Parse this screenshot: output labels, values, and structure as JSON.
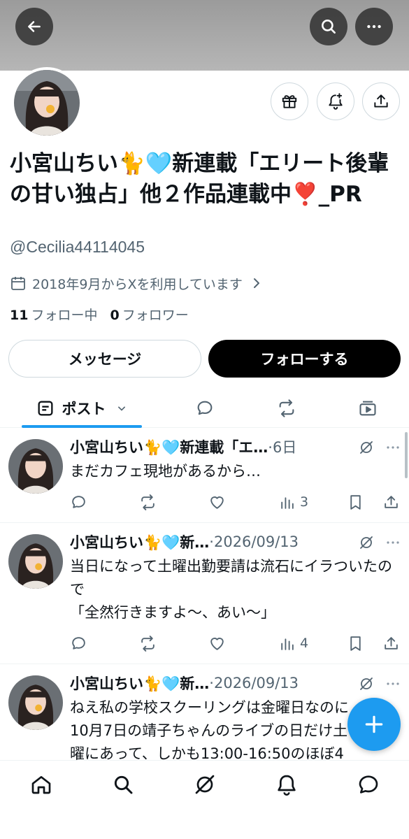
{
  "profile": {
    "display_name": "小宮山ちい🐈🩵新連載「エリート後輩の甘い独占」他２作品連載中❣️_PR",
    "handle": "@Cecilia44114045",
    "joined": "2018年9月からXを利用しています",
    "following_count": "11",
    "following_label": "フォロー中",
    "followers_count": "0",
    "followers_label": "フォロワー"
  },
  "buttons": {
    "message": "メッセージ",
    "follow": "フォローする"
  },
  "tabs": {
    "active_label": "ポスト",
    "items": [
      "posts-tab",
      "replies-tab",
      "reposts-tab",
      "media-tab"
    ]
  },
  "posts": [
    {
      "name": "小宮山ちい🐈🩵新連載「エ…",
      "date": "·6日",
      "body": "まだカフェ現地があるから…",
      "views": "3"
    },
    {
      "name": "小宮山ちい🐈🩵新…",
      "date": "·2026/09/13",
      "body": "当日になって土曜出勤要請は流石にイラついたので\n「全然行きますよ〜、あい〜」",
      "views": "4"
    },
    {
      "name": "小宮山ちい🐈🩵新…",
      "date": "·2026/09/13",
      "body": "ねえ私の学校スクーリングは金曜日なのに\n10月7日の靖子ちゃんのライブの日だけ土\n曜にあって、しかも13:00-16:50のほぼ4",
      "views": ""
    }
  ],
  "colors": {
    "accent": "#1d9bf0",
    "text": "#0f1419",
    "secondary": "#536471",
    "follow_button": "#000000"
  },
  "icons": {
    "header": [
      "back-arrow-icon",
      "search-icon",
      "more-icon"
    ],
    "actions": [
      "gift-icon",
      "notification-bell-plus-icon",
      "share-icon"
    ],
    "nav": [
      "home-icon",
      "explore-icon",
      "grok-icon",
      "notifications-icon",
      "messages-icon"
    ]
  }
}
